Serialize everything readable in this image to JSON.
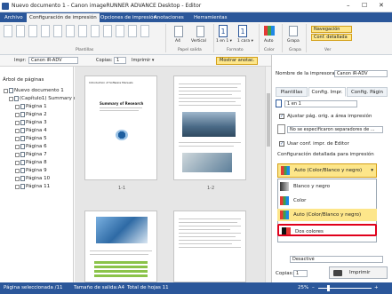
{
  "window": {
    "title": "Nuevo documento 1 - Canon imageRUNNER ADVANCE Desktop - Editor",
    "minimize": "–",
    "maximize": "☐",
    "close": "✕"
  },
  "tabs": [
    "Archivo",
    "Configuración de impresión",
    "Opciones de impresión",
    "Anotaciones",
    "Herramientas"
  ],
  "ribbon": {
    "groups": [
      "Plantillas",
      "Papel salida",
      "Formato",
      "Color",
      "Grapa",
      "Ver"
    ],
    "layout_labels": [
      "A4",
      "Vertical"
    ],
    "pages_per_sheet": "1",
    "pages_per_sheet_label": "1 en 1 ▾",
    "sides": "1",
    "sides_label": "1 cara ▾",
    "color_label": "Auto",
    "staple_label": "Grapa",
    "view_buttons": [
      "Navegación",
      "Conf. detallada"
    ],
    "show_annotations": "Mostrar anotac."
  },
  "toolbar": {
    "printer_label": "Impr:",
    "printer_value": "Canon iR-ADV",
    "copies_label": "Copias:",
    "copies_value": "1",
    "print_label": "Imprimir ▾"
  },
  "left_pane": {
    "title": "Árbol de páginas",
    "items": [
      {
        "label": "Nuevo documento 1",
        "level": 0
      },
      {
        "label": "(Capítulo1) Summary o",
        "level": 1
      },
      {
        "label": "Página 1",
        "level": 2
      },
      {
        "label": "Página 2",
        "level": 2
      },
      {
        "label": "Página 3",
        "level": 2
      },
      {
        "label": "Página 4",
        "level": 2
      },
      {
        "label": "Página 5",
        "level": 2
      },
      {
        "label": "Página 6",
        "level": 2
      },
      {
        "label": "Página 7",
        "level": 2
      },
      {
        "label": "Página 8",
        "level": 2
      },
      {
        "label": "Página 9",
        "level": 2
      },
      {
        "label": "Página 10",
        "level": 2
      },
      {
        "label": "Página 11",
        "level": 2
      }
    ]
  },
  "center": {
    "page_labels": [
      "1-1",
      "1-2"
    ],
    "doc_title": "Summary of Research",
    "doc_header": "Introduction of Software Manuals"
  },
  "right_pane": {
    "printer_name_label": "Nombre de la impresora",
    "printer_name_value": "Canon iR-ADV",
    "tabs": [
      "Plantillas",
      "Config. Impr.",
      "Config. Págin"
    ],
    "n_up_value": "1 en 1",
    "adjust_label": "Ajustar pág. orig. a área impresión",
    "separator_value": "No se especificaron separadores de ...",
    "use_printer_conf_label": "Usar conf. impr. de Editor",
    "detailed_config_label": "Configuración detallada para impresión",
    "color_selected": "Auto (Color/Blanco y negro)",
    "color_options": [
      "Blanco y negro",
      "Color",
      "Auto (Color/Blanco y negro)",
      "Dos colores"
    ],
    "bottom_value": "Desactivé",
    "copies_label": "Copias:",
    "copies_value": "1",
    "print_button": "Imprimir"
  },
  "status": {
    "selected": "Página seleccionada /11",
    "size": "Tamaño de salida:A4",
    "total": "Total de hojas 11",
    "zoom": "25%",
    "minus": "–",
    "plus": "+"
  }
}
